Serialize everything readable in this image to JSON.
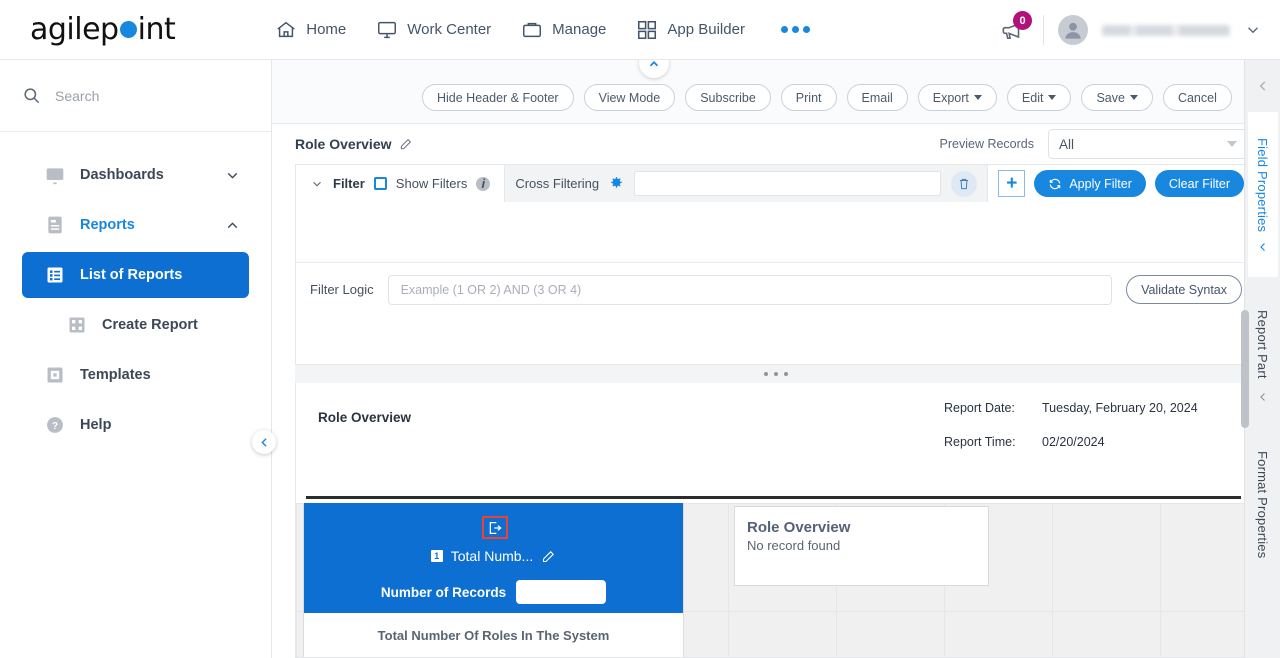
{
  "brand": {
    "name_part1": "agilep",
    "name_part2": "int",
    "accent": "#1787e0"
  },
  "topnav": {
    "items": [
      {
        "label": "Home",
        "icon": "home-icon"
      },
      {
        "label": "Work Center",
        "icon": "monitor-icon"
      },
      {
        "label": "Manage",
        "icon": "briefcase-icon"
      },
      {
        "label": "App Builder",
        "icon": "grid-icon"
      }
    ],
    "more_label": "•••",
    "notification_count": "0",
    "user_name": ""
  },
  "sidebar": {
    "search_placeholder": "Search",
    "items": [
      {
        "label": "Dashboards",
        "icon": "dashboard-icon",
        "state": "collapsed",
        "chevron": "chevron-down-icon"
      },
      {
        "label": "Reports",
        "icon": "report-icon",
        "state": "expanded",
        "chevron": "chevron-up-icon"
      },
      {
        "label": "List of Reports",
        "icon": "list-icon",
        "state": "active"
      },
      {
        "label": "Create Report",
        "icon": "create-report-icon",
        "state": "normal"
      },
      {
        "label": "Templates",
        "icon": "template-icon",
        "state": "normal"
      },
      {
        "label": "Help",
        "icon": "help-icon",
        "state": "normal"
      }
    ]
  },
  "toolbar": {
    "buttons": [
      {
        "label": "Hide Header & Footer",
        "caret": false
      },
      {
        "label": "View Mode",
        "caret": false
      },
      {
        "label": "Subscribe",
        "caret": false
      },
      {
        "label": "Print",
        "caret": false
      },
      {
        "label": "Email",
        "caret": false
      },
      {
        "label": "Export",
        "caret": true
      },
      {
        "label": "Edit",
        "caret": true
      },
      {
        "label": "Save",
        "caret": true
      },
      {
        "label": "Cancel",
        "caret": false
      }
    ]
  },
  "report": {
    "title": "Role Overview",
    "preview_records_label": "Preview Records",
    "preview_records_value": "All",
    "header_title": "Role Overview",
    "report_date_label": "Report Date:",
    "report_date_value": "Tuesday, February 20, 2024",
    "report_time_label": "Report Time:",
    "report_time_value": "02/20/2024"
  },
  "filter": {
    "section_label": "Filter",
    "show_filters_label": "Show Filters",
    "cross_filtering_label": "Cross Filtering",
    "cross_filtering_value": "",
    "add_label": "+",
    "apply_label": "Apply Filter",
    "clear_label": "Clear Filter",
    "logic_label": "Filter Logic",
    "logic_placeholder": "Example (1 OR 2) AND (3 OR 4)",
    "logic_value": "",
    "validate_label": "Validate Syntax"
  },
  "widget": {
    "badge_number": "1",
    "title": "Total Numb...",
    "field_label": "Number of Records",
    "field_value": "",
    "subtitle": "Total Number Of Roles In The System",
    "highlight_color": "#f1402f",
    "panel_color": "#0d6fd1"
  },
  "record_card": {
    "title": "Role Overview",
    "message": "No record found"
  },
  "right_rail": {
    "tabs": [
      {
        "label": "Field Properties",
        "state": "active"
      },
      {
        "label": "Report Part",
        "state": "normal"
      },
      {
        "label": "Format Properties",
        "state": "normal"
      }
    ]
  }
}
